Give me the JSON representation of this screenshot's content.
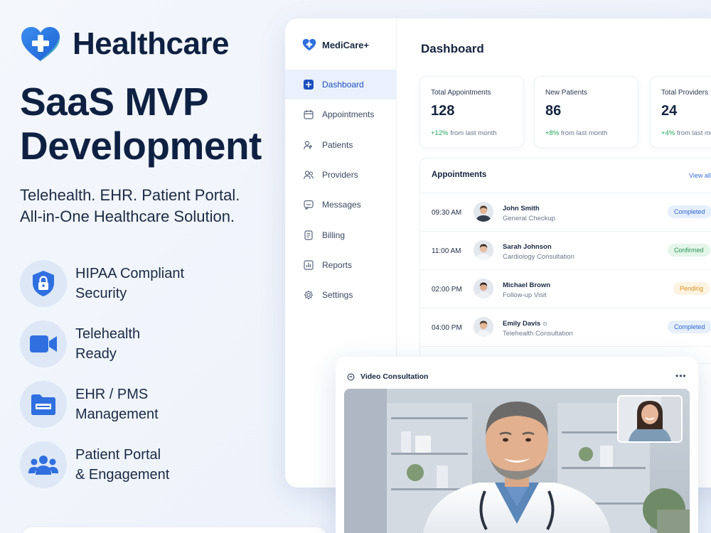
{
  "brand": {
    "name": "Healthcare"
  },
  "hero": {
    "line1": "SaaS MVP",
    "line2": "Development"
  },
  "tagline": {
    "line1": "Telehealth. EHR. Patient Portal.",
    "line2": "All-in-One Healthcare Solution."
  },
  "features": [
    {
      "icon": "lock-shield-icon",
      "line1": "HIPAA Compliant",
      "line2": "Security"
    },
    {
      "icon": "video-camera-icon",
      "line1": "Telehealth",
      "line2": "Ready"
    },
    {
      "icon": "folder-icon",
      "line1": "EHR / PMS",
      "line2": "Management"
    },
    {
      "icon": "users-icon",
      "line1": "Patient Portal",
      "line2": "& Engagement"
    }
  ],
  "app": {
    "name": "MediCare+",
    "nav": [
      {
        "label": "Dashboard",
        "icon": "dashboard-icon",
        "active": true
      },
      {
        "label": "Appointments",
        "icon": "calendar-icon"
      },
      {
        "label": "Patients",
        "icon": "patients-icon"
      },
      {
        "label": "Providers",
        "icon": "providers-icon"
      },
      {
        "label": "Messages",
        "icon": "message-icon"
      },
      {
        "label": "Billing",
        "icon": "billing-icon"
      },
      {
        "label": "Reports",
        "icon": "reports-icon"
      },
      {
        "label": "Settings",
        "icon": "settings-icon"
      }
    ],
    "page_title": "Dashboard",
    "stats": [
      {
        "label": "Total Appointments",
        "value": "128",
        "change": "+12%",
        "change_text": "from last month"
      },
      {
        "label": "New Patients",
        "value": "86",
        "change": "+8%",
        "change_text": "from last month"
      },
      {
        "label": "Total Providers",
        "value": "24",
        "change": "+4%",
        "change_text": "from last month"
      }
    ],
    "appointments": {
      "title": "Appointments",
      "view_all": "View all",
      "rows": [
        {
          "time": "09:30 AM",
          "name": "John Smith",
          "desc": "General Checkup",
          "status": "Completed"
        },
        {
          "time": "11:00 AM",
          "name": "Sarah Johnson",
          "desc": "Cardiology Consultation",
          "status": "Confirmed"
        },
        {
          "time": "02:00 PM",
          "name": "Michael Brown",
          "desc": "Follow-up Visit",
          "status": "Pending"
        },
        {
          "time": "04:00 PM",
          "name": "Emily Davis",
          "desc": "Telehealth Consultation",
          "status": "Completed"
        }
      ]
    },
    "video": {
      "title": "Video Consultation",
      "menu": "•••"
    }
  },
  "colors": {
    "accent": "#1c4fbf",
    "brand_blue": "#2f6fe0",
    "completed_bg": "#e6effc",
    "completed_fg": "#2f66d0",
    "confirmed_bg": "#e4f5ea",
    "confirmed_fg": "#23964f",
    "pending_bg": "#fdf3e1",
    "pending_fg": "#d8941f"
  }
}
